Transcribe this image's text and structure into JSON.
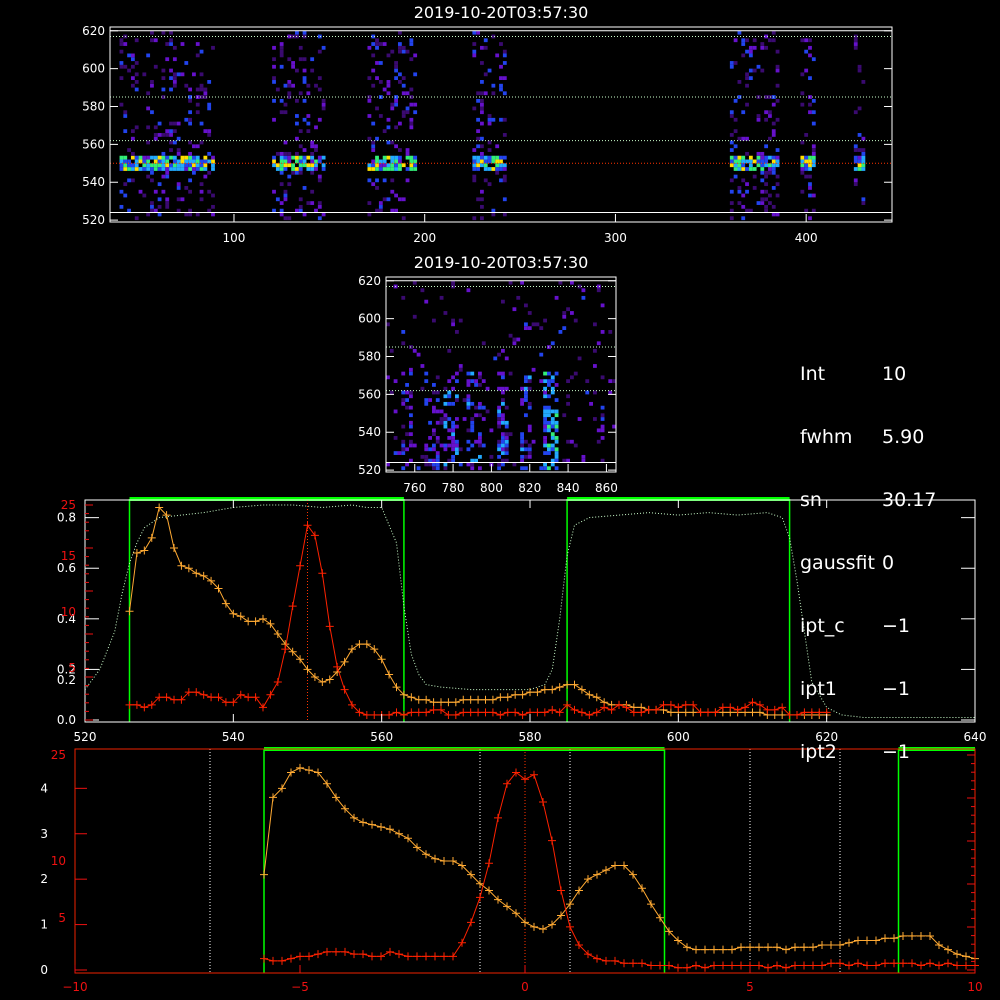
{
  "panels": {
    "top": {
      "title": "2019-10-20T03:57:30",
      "yticks": [
        "520",
        "540",
        "560",
        "580",
        "600",
        "620"
      ],
      "xticks": [
        "100",
        "200",
        "300",
        "400"
      ]
    },
    "mid": {
      "title": "2019-10-20T03:57:30",
      "yticks": [
        "520",
        "540",
        "560",
        "580",
        "600",
        "620"
      ],
      "xticks": [
        "760",
        "780",
        "800",
        "820",
        "840",
        "860"
      ]
    },
    "p3": {
      "xticks": [
        "520",
        "540",
        "560",
        "580",
        "600",
        "620",
        "640"
      ],
      "yticks_right": [
        "0.0",
        "0.2",
        "0.4",
        "0.6",
        "0.8"
      ],
      "yticks_left": [
        "5",
        "10",
        "15",
        "25"
      ],
      "yticks_left_extra": "0.2"
    },
    "p4": {
      "xticks": [
        "−10",
        "−5",
        "0",
        "5",
        "10"
      ],
      "yticks_white": [
        "0",
        "1",
        "2",
        "3",
        "4"
      ],
      "yticks_red": [
        "5",
        "10",
        "25"
      ]
    }
  },
  "info": [
    {
      "key": "Int",
      "value": "10"
    },
    {
      "key": "fwhm",
      "value": "5.90"
    },
    {
      "key": "sn",
      "value": "30.17"
    },
    {
      "key": "gaussfit",
      "value": "0"
    },
    {
      "key": "ipt_c",
      "value": "−1"
    },
    {
      "key": "ipt1",
      "value": "−1"
    },
    {
      "key": "ipt2",
      "value": "−1"
    }
  ],
  "colors": {
    "green": "#00ff00",
    "orange": "#ffaa33",
    "red": "#ff2200",
    "mint": "#ccffcc"
  },
  "chart_data": [
    {
      "type": "heatmap",
      "title": "2019-10-20T03:57:30",
      "xlim": [
        35,
        445
      ],
      "ylim": [
        519,
        622
      ],
      "bright_row": 549,
      "slit_segments_x": [
        [
          40,
          90
        ],
        [
          120,
          148
        ],
        [
          170,
          195
        ],
        [
          225,
          243
        ],
        [
          360,
          385
        ],
        [
          397,
          405
        ],
        [
          425,
          430
        ]
      ],
      "hlines_y": [
        524,
        550,
        562,
        585,
        617,
        620
      ]
    },
    {
      "type": "heatmap",
      "title": "2019-10-20T03:57:30",
      "xlim": [
        745,
        865
      ],
      "ylim": [
        519,
        622
      ],
      "hlines_y": [
        524,
        562,
        585,
        617,
        620
      ]
    },
    {
      "type": "line",
      "xlim": [
        520,
        640
      ],
      "ylim_right": [
        0,
        0.85
      ],
      "green_bands": [
        [
          526,
          563
        ],
        [
          585,
          615
        ]
      ],
      "vline_x": 550,
      "series": [
        {
          "color": "orange",
          "x": [
            526,
            527,
            528,
            529,
            530,
            531,
            532,
            533,
            534,
            535,
            536,
            537,
            538,
            539,
            540,
            541,
            542,
            543,
            544,
            545,
            546,
            547,
            548,
            549,
            550,
            551,
            552,
            553,
            554,
            555,
            556,
            557,
            558,
            559,
            560,
            561,
            562,
            563,
            564,
            565,
            566,
            567,
            568,
            569,
            570,
            571,
            572,
            573,
            574,
            575,
            576,
            577,
            578,
            579,
            580,
            581,
            582,
            583,
            584,
            585,
            586,
            587,
            588,
            589,
            590,
            591,
            592,
            593,
            594,
            595,
            596,
            597,
            598,
            599,
            600,
            601,
            602,
            603,
            604,
            605,
            606,
            607,
            608,
            609,
            610,
            611,
            612,
            613,
            614,
            615,
            616,
            617,
            618,
            619,
            620
          ],
          "y": [
            0.43,
            0.66,
            0.67,
            0.72,
            0.84,
            0.81,
            0.68,
            0.61,
            0.6,
            0.58,
            0.57,
            0.55,
            0.52,
            0.46,
            0.42,
            0.41,
            0.39,
            0.39,
            0.4,
            0.38,
            0.34,
            0.3,
            0.27,
            0.24,
            0.2,
            0.17,
            0.15,
            0.16,
            0.19,
            0.23,
            0.28,
            0.3,
            0.3,
            0.28,
            0.24,
            0.18,
            0.13,
            0.1,
            0.09,
            0.08,
            0.08,
            0.07,
            0.07,
            0.07,
            0.07,
            0.08,
            0.08,
            0.08,
            0.08,
            0.08,
            0.09,
            0.09,
            0.1,
            0.1,
            0.11,
            0.11,
            0.12,
            0.12,
            0.13,
            0.14,
            0.14,
            0.12,
            0.1,
            0.09,
            0.07,
            0.06,
            0.06,
            0.06,
            0.05,
            0.05,
            0.04,
            0.04,
            0.04,
            0.03,
            0.03,
            0.03,
            0.03,
            0.03,
            0.03,
            0.03,
            0.03,
            0.03,
            0.03,
            0.03,
            0.03,
            0.03,
            0.02,
            0.02,
            0.02,
            0.02,
            0.02,
            0.02,
            0.02,
            0.02,
            0.02
          ]
        },
        {
          "color": "red",
          "x": [
            526,
            527,
            528,
            529,
            530,
            531,
            532,
            533,
            534,
            535,
            536,
            537,
            538,
            539,
            540,
            541,
            542,
            543,
            544,
            545,
            546,
            547,
            548,
            549,
            550,
            551,
            552,
            553,
            554,
            555,
            556,
            557,
            558,
            559,
            560,
            561,
            562,
            563,
            564,
            565,
            566,
            567,
            568,
            569,
            570,
            571,
            572,
            573,
            574,
            575,
            576,
            577,
            578,
            579,
            580,
            581,
            582,
            583,
            584,
            585,
            586,
            587,
            588,
            589,
            590,
            591,
            592,
            593,
            594,
            595,
            596,
            597,
            598,
            599,
            600,
            601,
            602,
            603,
            604,
            605,
            606,
            607,
            608,
            609,
            610,
            611,
            612,
            613,
            614,
            615,
            616,
            617,
            618,
            619,
            620
          ],
          "y": [
            0.06,
            0.06,
            0.05,
            0.06,
            0.09,
            0.09,
            0.08,
            0.08,
            0.11,
            0.11,
            0.1,
            0.09,
            0.09,
            0.07,
            0.07,
            0.1,
            0.09,
            0.09,
            0.05,
            0.1,
            0.15,
            0.28,
            0.45,
            0.61,
            0.77,
            0.73,
            0.58,
            0.37,
            0.21,
            0.12,
            0.06,
            0.03,
            0.02,
            0.02,
            0.02,
            0.02,
            0.03,
            0.02,
            0.03,
            0.03,
            0.03,
            0.04,
            0.04,
            0.02,
            0.02,
            0.03,
            0.03,
            0.03,
            0.03,
            0.03,
            0.02,
            0.03,
            0.03,
            0.02,
            0.03,
            0.03,
            0.03,
            0.04,
            0.03,
            0.06,
            0.04,
            0.03,
            0.02,
            0.03,
            0.05,
            0.04,
            0.06,
            0.05,
            0.03,
            0.03,
            0.04,
            0.04,
            0.06,
            0.06,
            0.05,
            0.06,
            0.06,
            0.03,
            0.03,
            0.03,
            0.05,
            0.05,
            0.04,
            0.05,
            0.07,
            0.06,
            0.04,
            0.04,
            0.05,
            0.02,
            0.02,
            0.03,
            0.03,
            0.03,
            0.03
          ]
        },
        {
          "color": "mint",
          "style": "dotted",
          "x": [
            520,
            522,
            524,
            525,
            526,
            527,
            528,
            530,
            533,
            536,
            540,
            544,
            548,
            552,
            556,
            558,
            560,
            562,
            563,
            564,
            565,
            566,
            568,
            572,
            576,
            580,
            582,
            583,
            584,
            585,
            586,
            588,
            592,
            596,
            600,
            604,
            608,
            612,
            614,
            615,
            616,
            617,
            618,
            620,
            622,
            625,
            630,
            635,
            640
          ],
          "y": [
            0.12,
            0.2,
            0.35,
            0.5,
            0.62,
            0.7,
            0.76,
            0.8,
            0.81,
            0.82,
            0.84,
            0.85,
            0.85,
            0.84,
            0.85,
            0.84,
            0.84,
            0.7,
            0.45,
            0.26,
            0.18,
            0.14,
            0.13,
            0.12,
            0.12,
            0.12,
            0.14,
            0.2,
            0.4,
            0.65,
            0.77,
            0.8,
            0.81,
            0.82,
            0.81,
            0.82,
            0.81,
            0.82,
            0.8,
            0.72,
            0.55,
            0.35,
            0.15,
            0.05,
            0.02,
            0.01,
            0.01,
            0.01,
            0.01
          ]
        }
      ]
    },
    {
      "type": "line",
      "xlim": [
        -10,
        10
      ],
      "ylim": [
        0,
        4.8
      ],
      "green_bands": [
        [
          -5.8,
          3.1
        ],
        [
          8.3,
          10
        ]
      ],
      "vlines_x": [
        -7,
        -1,
        0,
        1,
        5,
        7
      ],
      "series": [
        {
          "color": "orange",
          "x": [
            -5.8,
            -5.6,
            -5.4,
            -5.2,
            -5.0,
            -4.8,
            -4.6,
            -4.4,
            -4.2,
            -4.0,
            -3.8,
            -3.6,
            -3.4,
            -3.2,
            -3.0,
            -2.8,
            -2.6,
            -2.4,
            -2.2,
            -2.0,
            -1.8,
            -1.6,
            -1.4,
            -1.2,
            -1.0,
            -0.8,
            -0.6,
            -0.4,
            -0.2,
            0.0,
            0.2,
            0.4,
            0.6,
            0.8,
            1.0,
            1.2,
            1.4,
            1.6,
            1.8,
            2.0,
            2.2,
            2.4,
            2.6,
            2.8,
            3.0,
            3.2,
            3.4,
            3.6,
            3.8,
            4.0,
            4.2,
            4.4,
            4.6,
            4.8,
            5.0,
            5.2,
            5.4,
            5.6,
            5.8,
            6.0,
            6.2,
            6.4,
            6.6,
            6.8,
            7.0,
            7.2,
            7.4,
            7.6,
            7.8,
            8.0,
            8.2,
            8.4,
            8.6,
            8.8,
            9.0,
            9.2,
            9.4,
            9.6,
            9.8,
            10.0
          ],
          "y": [
            2.1,
            3.8,
            4.0,
            4.35,
            4.45,
            4.4,
            4.35,
            4.1,
            3.8,
            3.55,
            3.35,
            3.25,
            3.2,
            3.15,
            3.1,
            3.0,
            2.9,
            2.7,
            2.55,
            2.45,
            2.4,
            2.4,
            2.3,
            2.1,
            1.9,
            1.75,
            1.55,
            1.4,
            1.25,
            1.05,
            0.95,
            0.9,
            1.0,
            1.2,
            1.45,
            1.75,
            2.0,
            2.1,
            2.2,
            2.3,
            2.3,
            2.1,
            1.8,
            1.45,
            1.15,
            0.85,
            0.65,
            0.5,
            0.45,
            0.45,
            0.45,
            0.45,
            0.45,
            0.5,
            0.5,
            0.5,
            0.5,
            0.5,
            0.45,
            0.5,
            0.5,
            0.5,
            0.55,
            0.55,
            0.55,
            0.6,
            0.65,
            0.65,
            0.65,
            0.7,
            0.7,
            0.75,
            0.75,
            0.75,
            0.75,
            0.55,
            0.45,
            0.35,
            0.3,
            0.25
          ]
        },
        {
          "color": "red",
          "x": [
            -5.8,
            -5.6,
            -5.4,
            -5.2,
            -5.0,
            -4.8,
            -4.6,
            -4.4,
            -4.2,
            -4.0,
            -3.8,
            -3.6,
            -3.4,
            -3.2,
            -3.0,
            -2.8,
            -2.6,
            -2.4,
            -2.2,
            -2.0,
            -1.8,
            -1.6,
            -1.4,
            -1.2,
            -1.0,
            -0.8,
            -0.6,
            -0.4,
            -0.2,
            0.0,
            0.2,
            0.4,
            0.6,
            0.8,
            1.0,
            1.2,
            1.4,
            1.6,
            1.8,
            2.0,
            2.2,
            2.4,
            2.6,
            2.8,
            3.0,
            3.2,
            3.4,
            3.6,
            3.8,
            4.0,
            4.2,
            4.4,
            4.6,
            4.8,
            5.0,
            5.2,
            5.4,
            5.6,
            5.8,
            6.0,
            6.2,
            6.4,
            6.6,
            6.8,
            7.0,
            7.2,
            7.4,
            7.6,
            7.8,
            8.0,
            8.2,
            8.4,
            8.6,
            8.8,
            9.0,
            9.2,
            9.4,
            9.6,
            9.8,
            10.0
          ],
          "y": [
            0.25,
            0.2,
            0.2,
            0.25,
            0.3,
            0.3,
            0.35,
            0.4,
            0.4,
            0.4,
            0.35,
            0.35,
            0.3,
            0.3,
            0.4,
            0.35,
            0.3,
            0.3,
            0.3,
            0.3,
            0.3,
            0.3,
            0.6,
            1.05,
            1.6,
            2.35,
            3.35,
            4.1,
            4.35,
            4.2,
            4.3,
            3.7,
            2.85,
            1.75,
            0.95,
            0.55,
            0.35,
            0.25,
            0.2,
            0.2,
            0.15,
            0.15,
            0.15,
            0.1,
            0.1,
            0.1,
            0.05,
            0.05,
            0.1,
            0.05,
            0.1,
            0.1,
            0.1,
            0.1,
            0.1,
            0.1,
            0.05,
            0.1,
            0.05,
            0.1,
            0.1,
            0.1,
            0.1,
            0.15,
            0.15,
            0.1,
            0.15,
            0.1,
            0.1,
            0.15,
            0.15,
            0.15,
            0.15,
            0.1,
            0.15,
            0.1,
            0.15,
            0.1,
            0.1,
            0.1
          ]
        }
      ]
    }
  ]
}
